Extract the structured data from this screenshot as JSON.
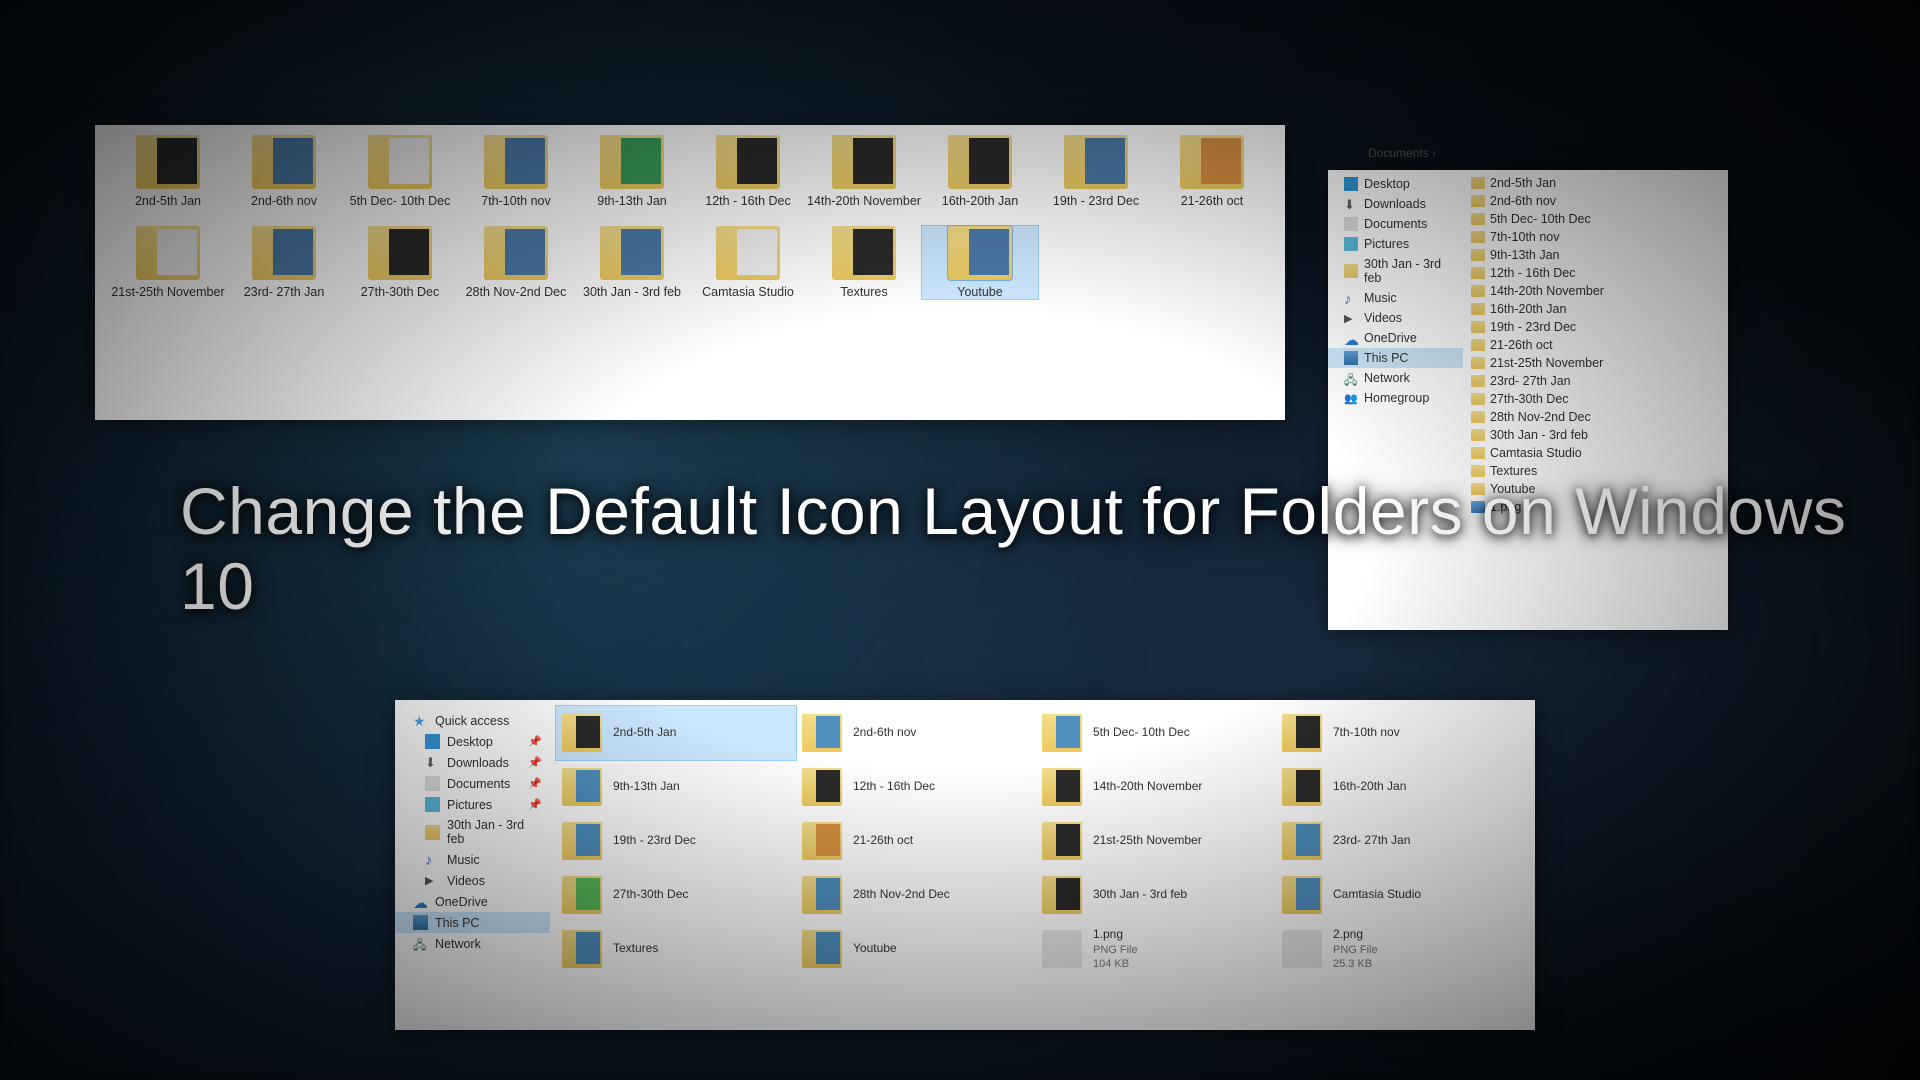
{
  "title": "Change the Default Icon Layout for\nFolders on Windows 10",
  "panel1": {
    "items": [
      {
        "label": "2nd-5th Jan",
        "th": "dk"
      },
      {
        "label": "2nd-6th nov",
        "th": "bl"
      },
      {
        "label": "5th Dec- 10th Dec",
        "th": "wt"
      },
      {
        "label": "7th-10th nov",
        "th": "bl"
      },
      {
        "label": "9th-13th Jan",
        "th": "gn"
      },
      {
        "label": "12th - 16th Dec",
        "th": "dk"
      },
      {
        "label": "14th-20th November",
        "th": "dk"
      },
      {
        "label": "16th-20th Jan",
        "th": "dk"
      },
      {
        "label": "19th - 23rd Dec",
        "th": "bl"
      },
      {
        "label": "21-26th oct",
        "th": "or"
      },
      {
        "label": "21st-25th November",
        "th": "wt"
      },
      {
        "label": "23rd- 27th Jan",
        "th": "bl"
      },
      {
        "label": "27th-30th Dec",
        "th": "dk"
      },
      {
        "label": "28th Nov-2nd Dec",
        "th": "bl"
      },
      {
        "label": "30th Jan - 3rd feb",
        "th": "bl"
      },
      {
        "label": "Camtasia Studio",
        "th": "wt"
      },
      {
        "label": "Textures",
        "th": "dk"
      },
      {
        "label": "Youtube",
        "th": "bl",
        "sel": true
      }
    ]
  },
  "panel2": {
    "breadcrumb": "Documents  ›",
    "nav": [
      {
        "label": "Desktop",
        "ico": "desk"
      },
      {
        "label": "Downloads",
        "ico": "dl"
      },
      {
        "label": "Documents",
        "ico": "doc"
      },
      {
        "label": "Pictures",
        "ico": "pic"
      },
      {
        "label": "30th Jan - 3rd feb",
        "ico": "fld"
      },
      {
        "label": "Music",
        "ico": "mus"
      },
      {
        "label": "Videos",
        "ico": "vid"
      },
      {
        "label": "OneDrive",
        "ico": "od"
      },
      {
        "label": "This PC",
        "ico": "pc",
        "sel": true
      },
      {
        "label": "Network",
        "ico": "net"
      },
      {
        "label": "Homegroup",
        "ico": "hg"
      }
    ],
    "list": [
      {
        "label": "2nd-5th Jan"
      },
      {
        "label": "2nd-6th nov"
      },
      {
        "label": "5th Dec- 10th Dec"
      },
      {
        "label": "7th-10th nov"
      },
      {
        "label": "9th-13th Jan"
      },
      {
        "label": "12th - 16th Dec"
      },
      {
        "label": "14th-20th November"
      },
      {
        "label": "16th-20th Jan"
      },
      {
        "label": "19th - 23rd Dec"
      },
      {
        "label": "21-26th oct"
      },
      {
        "label": "21st-25th November"
      },
      {
        "label": "23rd- 27th Jan"
      },
      {
        "label": "27th-30th Dec"
      },
      {
        "label": "28th Nov-2nd Dec"
      },
      {
        "label": "30th Jan - 3rd feb"
      },
      {
        "label": "Camtasia Studio"
      },
      {
        "label": "Textures"
      },
      {
        "label": "Youtube"
      },
      {
        "label": "1.png",
        "img": true
      }
    ]
  },
  "panel3": {
    "nav": [
      {
        "label": "Quick access",
        "ico": "star"
      },
      {
        "label": "Desktop",
        "ico": "desk",
        "l2": true,
        "pin": true
      },
      {
        "label": "Downloads",
        "ico": "dl",
        "l2": true,
        "pin": true
      },
      {
        "label": "Documents",
        "ico": "doc",
        "l2": true,
        "pin": true
      },
      {
        "label": "Pictures",
        "ico": "pic",
        "l2": true,
        "pin": true
      },
      {
        "label": "30th Jan - 3rd feb",
        "ico": "fld",
        "l2": true
      },
      {
        "label": "Music",
        "ico": "mus",
        "l2": true
      },
      {
        "label": "Videos",
        "ico": "vid",
        "l2": true
      },
      {
        "label": "OneDrive",
        "ico": "od"
      },
      {
        "label": "This PC",
        "ico": "pc",
        "sel": true
      },
      {
        "label": "Network",
        "ico": "net"
      }
    ],
    "tiles": [
      {
        "label": "2nd-5th Jan",
        "th": "dk",
        "sel": true
      },
      {
        "label": "2nd-6th nov",
        "th": "bl"
      },
      {
        "label": "5th Dec- 10th Dec",
        "th": "bl"
      },
      {
        "label": "7th-10th nov",
        "th": "dk"
      },
      {
        "label": "9th-13th Jan",
        "th": "bl"
      },
      {
        "label": "12th - 16th Dec",
        "th": "dk"
      },
      {
        "label": "14th-20th November",
        "th": "dk"
      },
      {
        "label": "16th-20th Jan",
        "th": "dk"
      },
      {
        "label": "19th - 23rd Dec",
        "th": "bl"
      },
      {
        "label": "21-26th oct",
        "th": "or"
      },
      {
        "label": "21st-25th November",
        "th": "dk"
      },
      {
        "label": "23rd- 27th Jan",
        "th": "bl"
      },
      {
        "label": "27th-30th Dec",
        "th": "gn"
      },
      {
        "label": "28th Nov-2nd Dec",
        "th": "bl"
      },
      {
        "label": "30th Jan - 3rd feb",
        "th": "dk"
      },
      {
        "label": "Camtasia Studio",
        "th": "bl"
      },
      {
        "label": "Textures",
        "th": "bl"
      },
      {
        "label": "Youtube",
        "th": "bl"
      },
      {
        "label": "1.png",
        "sub": "PNG File\n104 KB",
        "img": true
      },
      {
        "label": "2.png",
        "sub": "PNG File\n25.3 KB",
        "img": true
      }
    ]
  }
}
